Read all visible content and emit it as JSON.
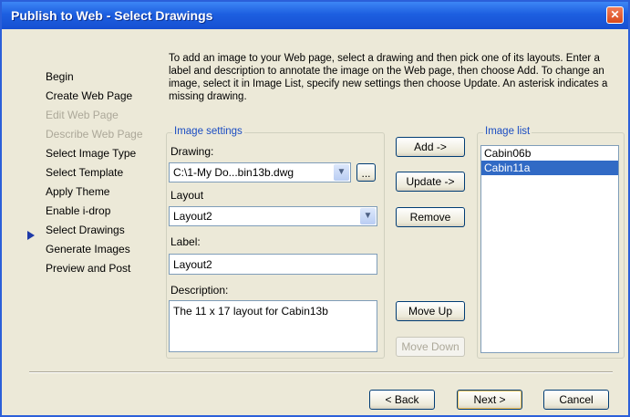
{
  "window": {
    "title": "Publish to Web - Select Drawings",
    "close_label": "✕"
  },
  "nav": {
    "items": [
      {
        "label": "Begin",
        "enabled": true
      },
      {
        "label": "Create Web Page",
        "enabled": true
      },
      {
        "label": "Edit Web Page",
        "enabled": false
      },
      {
        "label": "Describe Web Page",
        "enabled": false
      },
      {
        "label": "Select Image Type",
        "enabled": true
      },
      {
        "label": "Select Template",
        "enabled": true
      },
      {
        "label": "Apply Theme",
        "enabled": true
      },
      {
        "label": "Enable i-drop",
        "enabled": true
      },
      {
        "label": "Select Drawings",
        "enabled": true,
        "current": true
      },
      {
        "label": "Generate Images",
        "enabled": true
      },
      {
        "label": "Preview and Post",
        "enabled": true
      }
    ]
  },
  "instructions": "To add an image to your Web page, select a drawing and then pick one of its layouts. Enter a label and description to annotate the image on the Web page, then choose Add. To change an image, select it in Image List, specify new settings then choose Update. An asterisk indicates a missing drawing.",
  "image_settings": {
    "title": "Image settings",
    "drawing_label": "Drawing:",
    "drawing_value": "C:\\1-My Do...bin13b.dwg",
    "browse_label": "...",
    "layout_label": "Layout",
    "layout_value": "Layout2",
    "label_label": "Label:",
    "label_value": "Layout2",
    "description_label": "Description:",
    "description_value": "The 11 x 17 layout for Cabin13b"
  },
  "buttons": {
    "add": "Add ->",
    "update": "Update ->",
    "remove": "Remove",
    "move_up": "Move Up",
    "move_down": "Move Down",
    "back": "< Back",
    "next": "Next >",
    "cancel": "Cancel"
  },
  "image_list": {
    "title": "Image list",
    "items": [
      {
        "label": "Cabin06b",
        "selected": false
      },
      {
        "label": "Cabin11a",
        "selected": true
      }
    ]
  },
  "colors": {
    "title_bar": "#1d5fe0",
    "selection": "#316ac5",
    "group_title": "#1a4cc2"
  },
  "icons": {
    "nav_current": "triangle-right-icon",
    "dropdown": "chevron-down-icon",
    "close": "close-icon"
  }
}
